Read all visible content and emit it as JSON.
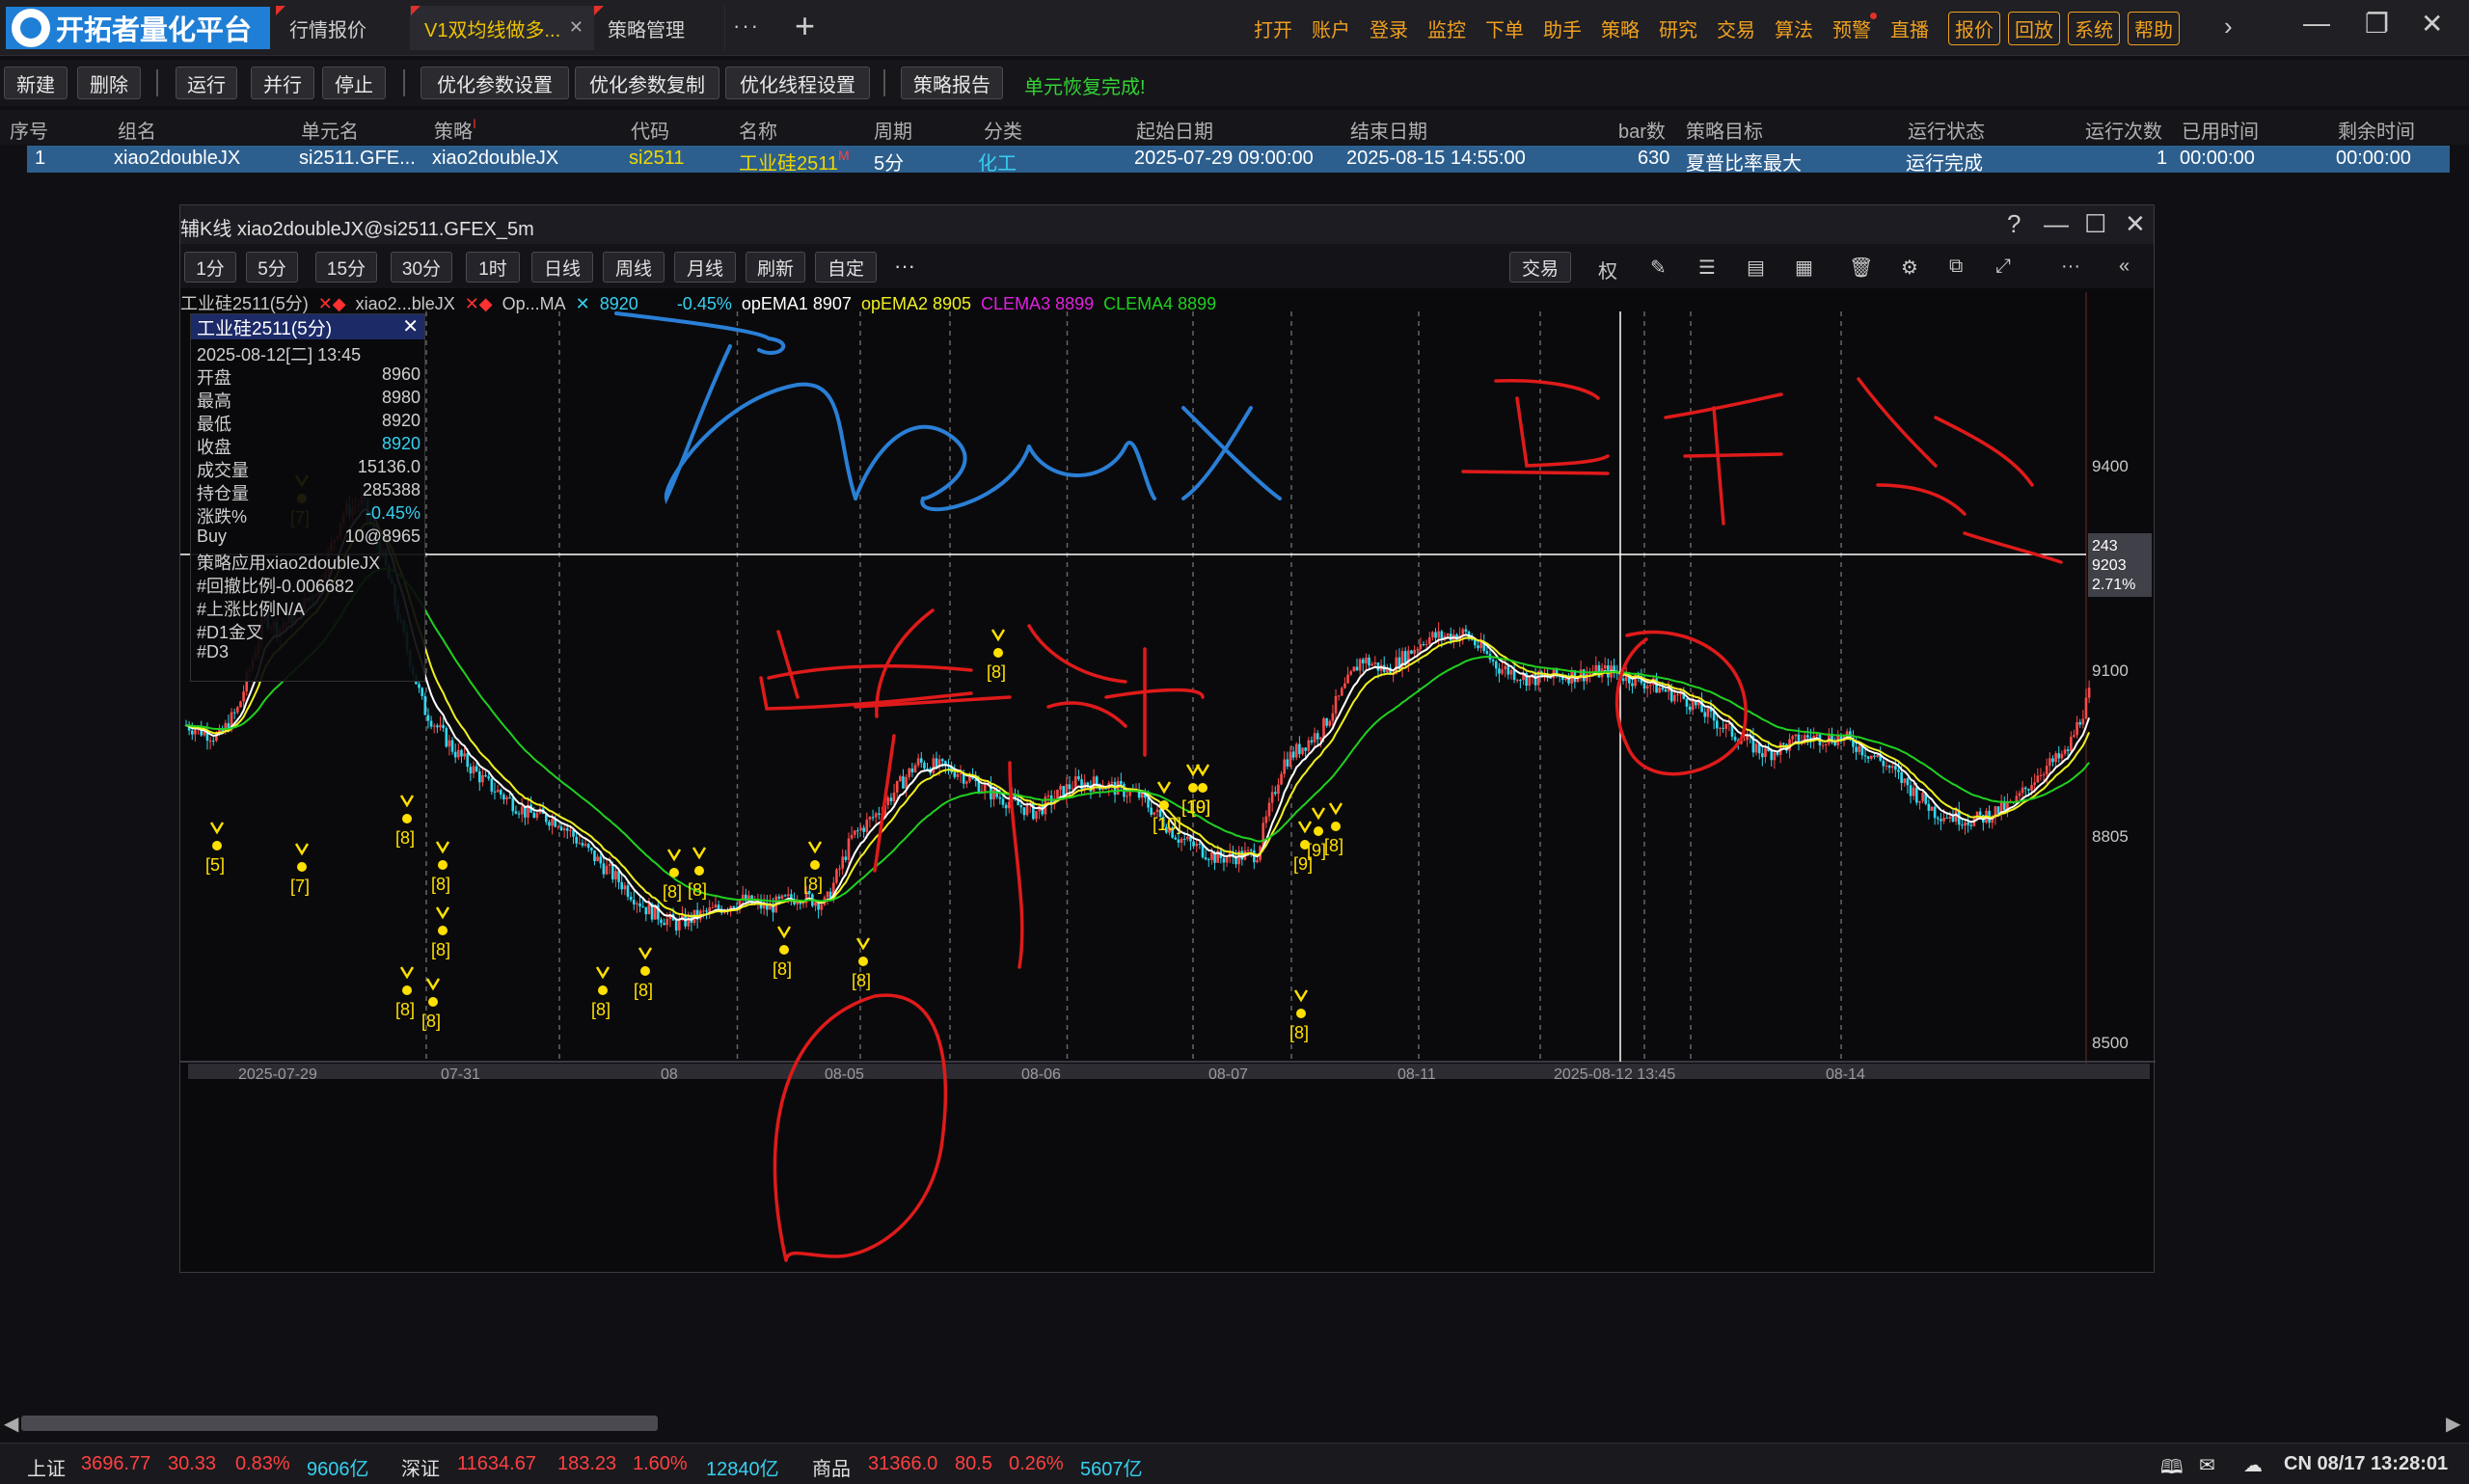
{
  "app": {
    "title": "开拓者量化平台"
  },
  "tabs": [
    {
      "label": "行情报价"
    },
    {
      "label": "V1双均线做多..."
    },
    {
      "label": "策略管理"
    }
  ],
  "tab_more": "···",
  "tab_add": "+",
  "top_menu": [
    "打开",
    "账户",
    "登录",
    "监控",
    "下单",
    "助手",
    "策略",
    "研究",
    "交易",
    "算法",
    "预警",
    "直播"
  ],
  "top_menu_boxed": [
    "报价",
    "回放",
    "系统",
    "帮助"
  ],
  "toolbar": {
    "buttons": [
      "新建",
      "删除",
      "运行",
      "并行",
      "停止",
      "优化参数设置",
      "优化参数复制",
      "优化线程设置",
      "策略报告"
    ],
    "status": "单元恢复完成!"
  },
  "table": {
    "headers": [
      "序号",
      "组名",
      "单元名",
      "策略",
      "代码",
      "名称",
      "周期",
      "分类",
      "起始日期",
      "结束日期",
      "bar数",
      "策略目标",
      "运行状态",
      "运行次数",
      "已用时间",
      "剩余时间"
    ],
    "row": {
      "index": "1",
      "group": "xiao2doubleJX",
      "unit": "si2511.GFE...",
      "strategy": "xiao2doubleJX",
      "code": "si2511",
      "name": "工业硅2511",
      "name_flag": "M",
      "period": "5分",
      "category": "化工",
      "start": "2025-07-29 09:00:00",
      "end": "2025-08-15 14:55:00",
      "bars": "630",
      "target": "夏普比率最大",
      "state": "运行完成",
      "runs": "1",
      "elapsed": "00:00:00",
      "remaining": "00:00:00"
    }
  },
  "chart": {
    "window_title": "辅K线 xiao2doubleJX@si2511.GFEX_5m",
    "periods": [
      "1分",
      "5分",
      "15分",
      "30分",
      "1时",
      "日线",
      "周线",
      "月线",
      "刷新",
      "自定"
    ],
    "more": "···",
    "trade_button": "交易",
    "quan": "权",
    "legend": {
      "instrument": "工业硅2511(5分)",
      "strat1": "xiao2...bleJX",
      "strat2": "Op...MA",
      "last": "8920",
      "change": "-0.45%",
      "ema1": "opEMA1 8907",
      "ema2": "opEMA2 8905",
      "clema3": "CLEMA3 8899",
      "clema4": "CLEMA4 8899"
    },
    "info": {
      "title": "工业硅2511(5分)",
      "datetime": "2025-08-12[二] 13:45",
      "rows": [
        {
          "label": "开盘",
          "value": "8960"
        },
        {
          "label": "最高",
          "value": "8980"
        },
        {
          "label": "最低",
          "value": "8920"
        },
        {
          "label": "收盘",
          "value": "8920"
        },
        {
          "label": "成交量",
          "value": "15136.0"
        },
        {
          "label": "持仓量",
          "value": "285388"
        },
        {
          "label": "涨跌%",
          "value": "-0.45%"
        },
        {
          "label": "Buy",
          "value": "10@8965"
        }
      ],
      "notes": [
        "策略应用xiao2doubleJX",
        "#回撤比例-0.006682",
        "#上涨比例N/A",
        "#D1金叉",
        "#D3"
      ]
    },
    "price_axis": [
      "9400",
      "9100",
      "8805",
      "8500"
    ],
    "cursor_box": [
      "243",
      "9203",
      "2.71%"
    ],
    "time_axis": [
      "2025-07-29",
      "07-31",
      "08",
      "08-05",
      "08-06",
      "08-07",
      "08-11",
      "2025-08-12 13:45",
      "08-14"
    ],
    "signal_labels": [
      "[5]",
      "[7]",
      "[7]",
      "[8]",
      "[8]",
      "[8]",
      "[8]",
      "[8]",
      "[8]",
      "[8]",
      "[8]",
      "[8]",
      "[8]",
      "[8]",
      "[8]",
      "[8]",
      "[10]",
      "[10]",
      "[9]",
      "[9]",
      "[9]",
      "[8]",
      "[8]"
    ],
    "colors": {
      "up": "#ff4a4a",
      "down": "#30d8f0",
      "ema_fast": "#ffffff",
      "ema_mid": "#f0f020",
      "ema_slow": "#20d020",
      "signal": "#ffe000"
    }
  },
  "bottom": {
    "shanghai": {
      "label": "上证",
      "price": "3696.77",
      "change": "30.33",
      "pct": "0.83%",
      "vol": "9606亿"
    },
    "shenzhen": {
      "label": "深证",
      "price": "11634.67",
      "change": "183.23",
      "pct": "1.60%",
      "vol": "12840亿"
    },
    "commodity": {
      "label": "商品",
      "price": "31366.0",
      "change": "80.5",
      "pct": "0.26%",
      "vol": "5607亿"
    },
    "clock": "CN 08/17 13:28:01"
  }
}
